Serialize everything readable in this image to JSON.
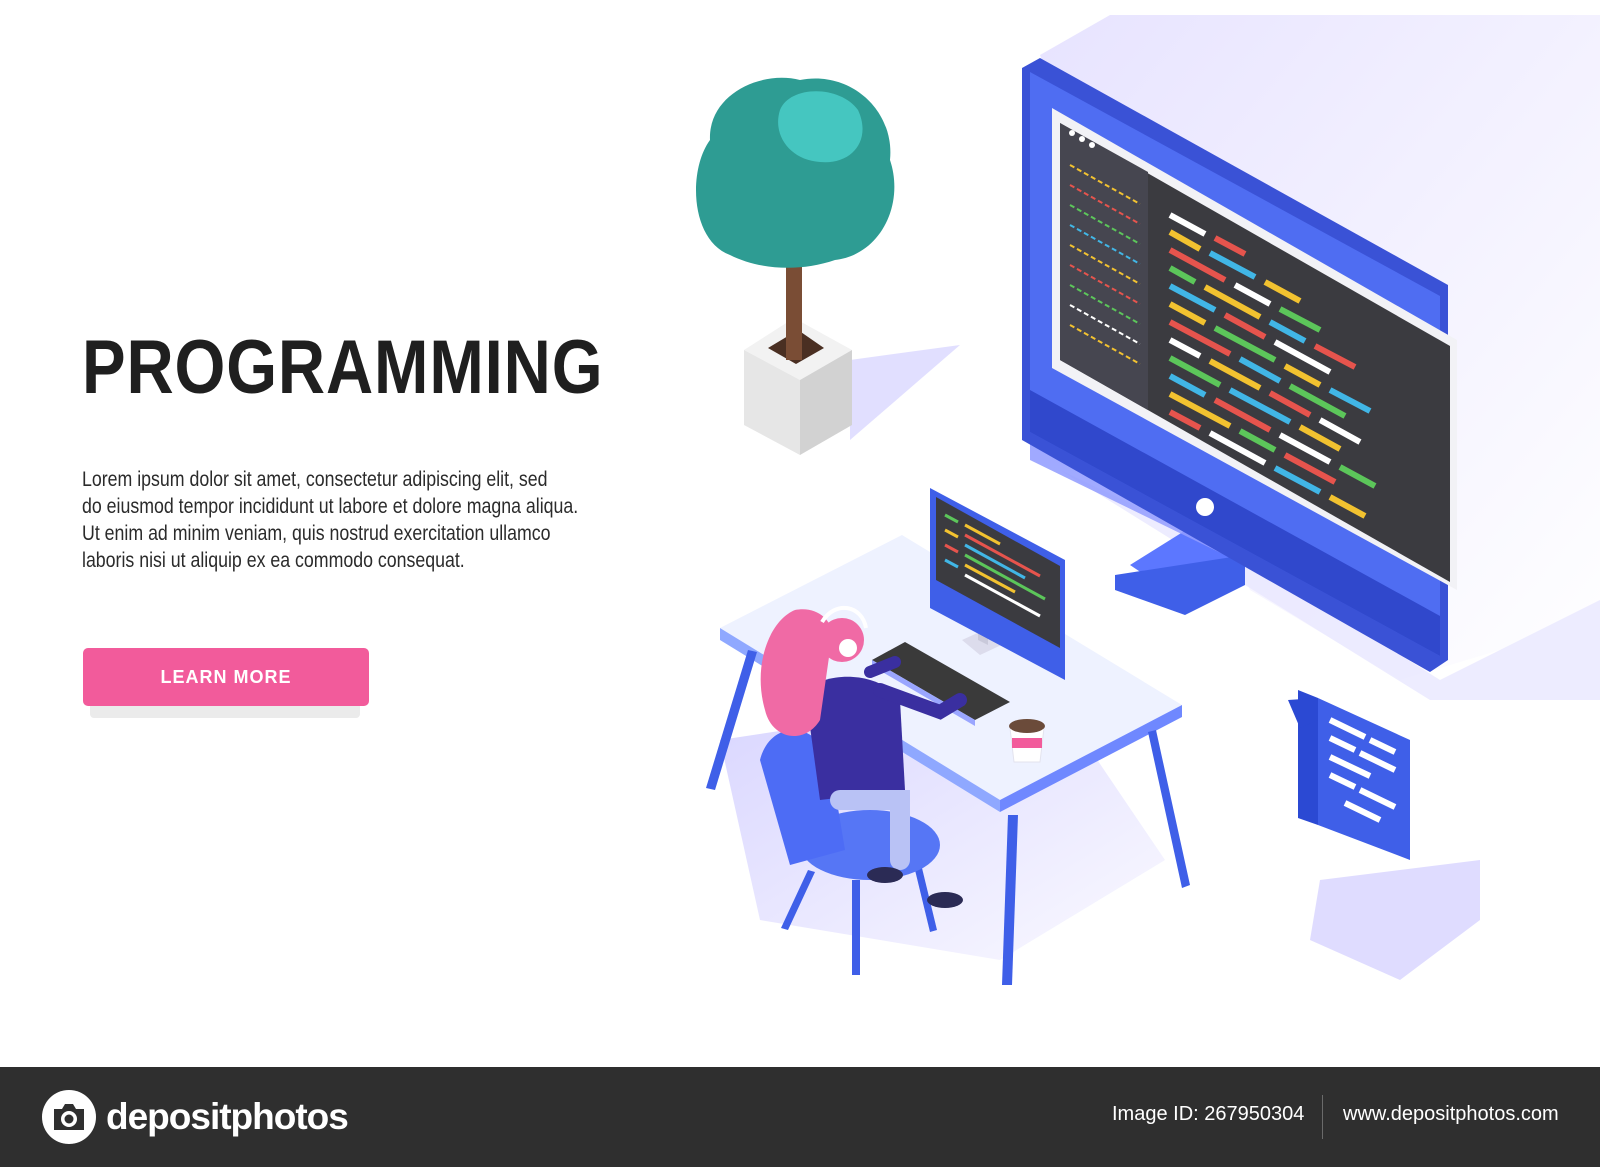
{
  "hero": {
    "title": "PROGRAMMING",
    "body_lines": [
      "Lorem ipsum dolor sit amet, consectetur adipiscing elit, sed",
      "do eiusmod tempor incididunt ut labore et dolore magna aliqua.",
      "Ut enim ad minim veniam, quis nostrud exercitation ullamco",
      "laboris nisi ut aliquip ex ea commodo consequat."
    ],
    "cta_label": "LEARN MORE"
  },
  "footer": {
    "brand": "depositphotos",
    "image_id": "Image ID: 267950304",
    "site": "www.depositphotos.com"
  },
  "watermark": "depositphotos",
  "colors": {
    "title": "#1f1f1f",
    "cta": "#f25b9b",
    "monitor_blue": "#3f5fe8",
    "screen": "#3b3b40",
    "footer_bg": "#2f2f2f"
  },
  "illustration": {
    "icons": [
      "potted-tree-icon",
      "large-monitor-icon",
      "small-monitor-icon",
      "keyboard-icon",
      "coffee-cup-icon",
      "code-chat-bubble-icon",
      "desk-icon",
      "chair-icon",
      "programmer-icon",
      "camera-logo-icon"
    ]
  }
}
